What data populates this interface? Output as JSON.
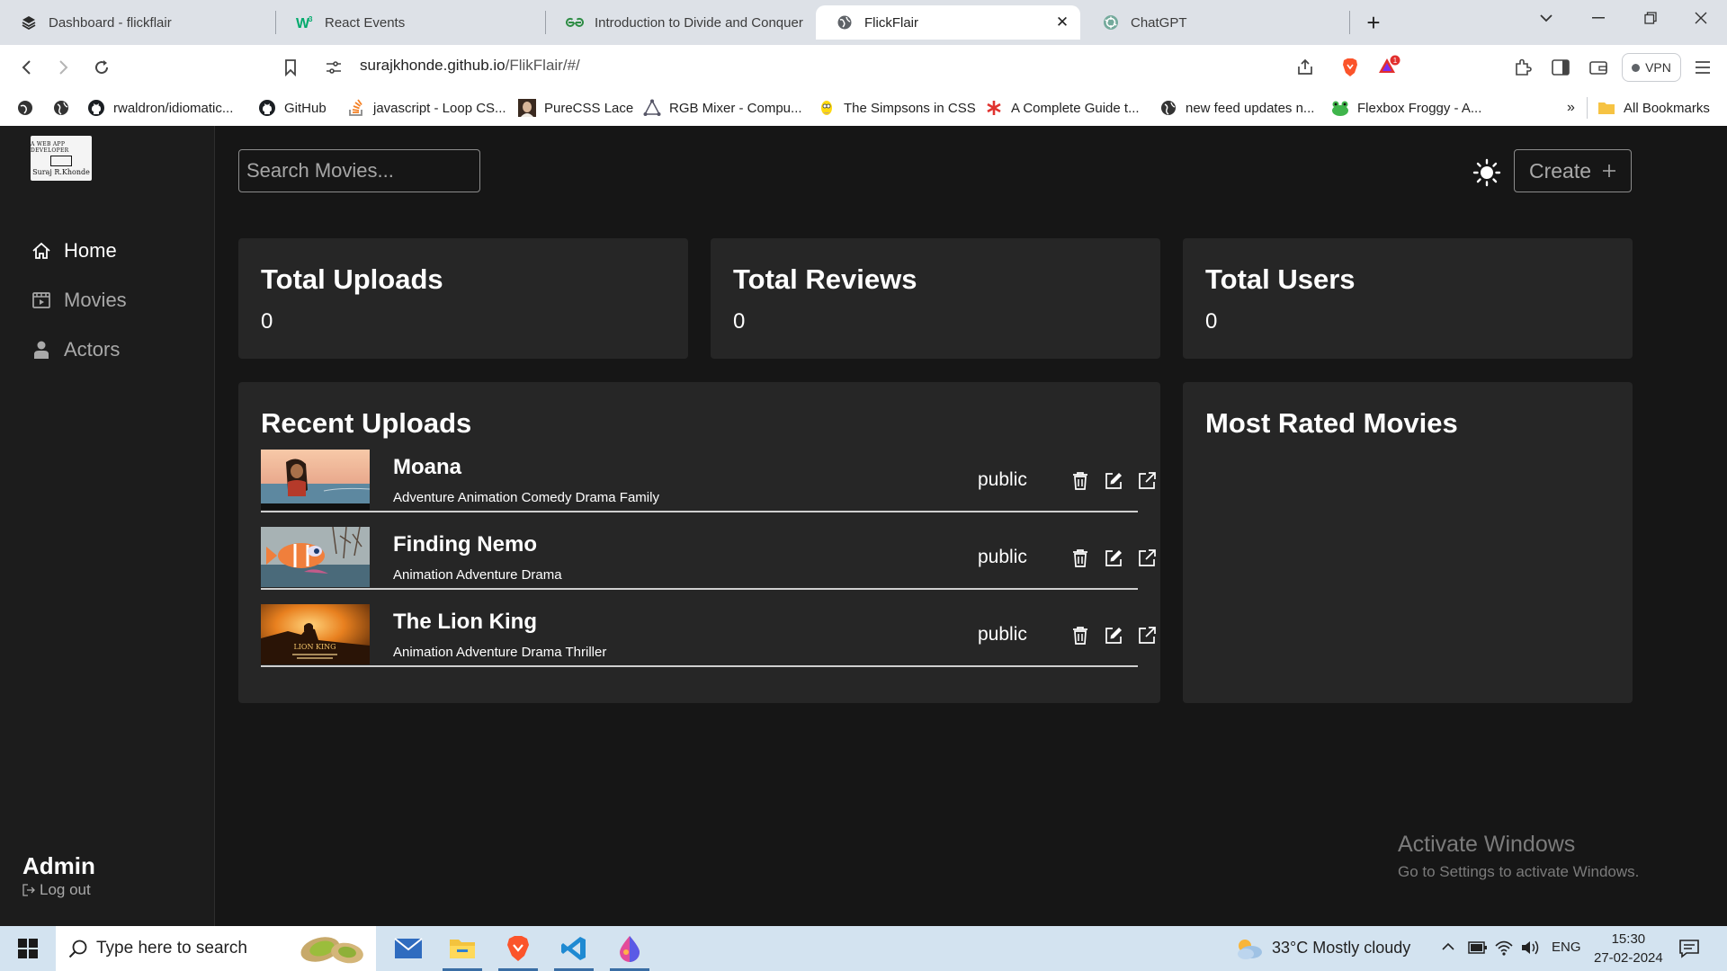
{
  "browser": {
    "tabs": [
      {
        "title": "Dashboard - flickflair",
        "icon": "layers-icon"
      },
      {
        "title": "React Events",
        "icon": "w3schools-icon"
      },
      {
        "title": "Introduction to Divide and Conquer",
        "icon": "gfg-icon"
      },
      {
        "title": "FlickFlair",
        "icon": "globe-icon"
      },
      {
        "title": "ChatGPT",
        "icon": "chatgpt-icon"
      }
    ],
    "active_tab_index": 3,
    "new_tab_label": "+",
    "url_host": "surajkhonde.github.io",
    "url_path": "/FlikFlair/#/",
    "vpn_label": "VPN",
    "notification_badge": "1",
    "bookmarks": [
      {
        "label": "",
        "icon": "site-icon"
      },
      {
        "label": "",
        "icon": "globe-icon"
      },
      {
        "label": "rwaldron/idiomatic...",
        "icon": "github-icon"
      },
      {
        "label": "GitHub",
        "icon": "github-icon"
      },
      {
        "label": "javascript - Loop CS...",
        "icon": "stackoverflow-icon"
      },
      {
        "label": "PureCSS Lace",
        "icon": "portrait-icon"
      },
      {
        "label": "RGB Mixer - Compu...",
        "icon": "triangle-icon"
      },
      {
        "label": "The Simpsons in CSS",
        "icon": "simpsons-icon"
      },
      {
        "label": "A Complete Guide t...",
        "icon": "asterisk-icon"
      },
      {
        "label": "new feed updates n...",
        "icon": "globe-icon"
      },
      {
        "label": "Flexbox Froggy - A...",
        "icon": "frog-icon"
      }
    ],
    "overflow_label": "»",
    "all_bookmarks_label": "All Bookmarks"
  },
  "app": {
    "logo_line1": "A WEB APP DEVELOPER",
    "logo_line2": "Suraj R.Khonde",
    "nav": [
      {
        "label": "Home",
        "icon": "home-icon",
        "active": true
      },
      {
        "label": "Movies",
        "icon": "film-icon",
        "active": false
      },
      {
        "label": "Actors",
        "icon": "actor-icon",
        "active": false
      }
    ],
    "admin_label": "Admin",
    "logout_label": "Log out",
    "search_placeholder": "Search Movies...",
    "create_label": "Create",
    "stats": [
      {
        "title": "Total Uploads",
        "value": "0"
      },
      {
        "title": "Total Reviews",
        "value": "0"
      },
      {
        "title": "Total Users",
        "value": "0"
      }
    ],
    "recent_uploads_title": "Recent Uploads",
    "recent_uploads": [
      {
        "title": "Moana",
        "genres": "Adventure Animation Comedy Drama Family",
        "status": "public"
      },
      {
        "title": "Finding Nemo",
        "genres": "Animation Adventure Drama",
        "status": "public"
      },
      {
        "title": "The Lion King",
        "genres": "Animation Adventure Drama Thriller",
        "status": "public"
      }
    ],
    "most_rated_title": "Most Rated Movies"
  },
  "watermark": {
    "line1": "Activate Windows",
    "line2": "Go to Settings to activate Windows."
  },
  "taskbar": {
    "search_placeholder": "Type here to search",
    "weather": "33°C  Mostly cloudy",
    "language": "ENG",
    "time": "15:30",
    "date": "27-02-2024"
  },
  "colors": {
    "app_bg": "#161616",
    "sidebar_bg": "#1c1c1c",
    "card_bg": "#262626",
    "text_primary": "#ffffff",
    "text_muted": "#a9a9a9",
    "taskbar_bg": "#d3e3f0"
  }
}
